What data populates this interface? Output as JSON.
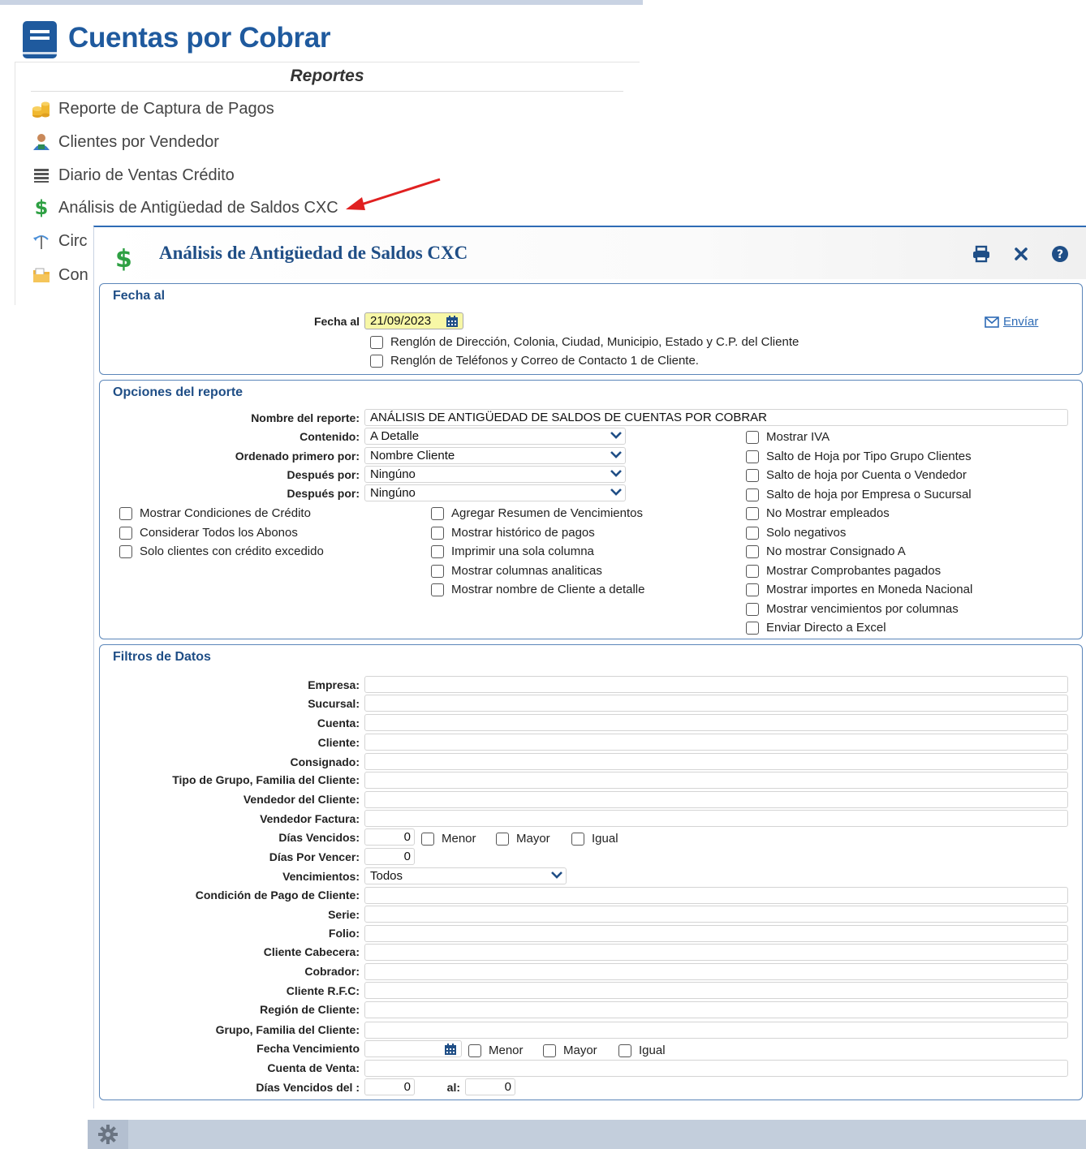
{
  "app": {
    "title": "Cuentas por Cobrar",
    "subtitle": "Reportes"
  },
  "menu_items": [
    {
      "label": "Reporte de Captura de Pagos",
      "icon": "coins-icon"
    },
    {
      "label": "Clientes por Vendedor",
      "icon": "users-icon"
    },
    {
      "label": "Diario de Ventas Crédito",
      "icon": "list-icon"
    },
    {
      "label": "Análisis de Antigüedad de Saldos CXC",
      "icon": "dollar-icon"
    },
    {
      "label": "Circ",
      "icon": "circular-icon"
    },
    {
      "label": "Con",
      "icon": "folder-icon"
    }
  ],
  "dialog": {
    "icon_glyph": "$",
    "title": "Análisis de Antigüedad de Saldos CXC"
  },
  "fecha": {
    "section_title": "Fecha al",
    "label": "Fecha al",
    "value": "21/09/2023",
    "send_link": "Envíar",
    "checks": [
      "Renglón de Dirección, Colonia, Ciudad, Municipio, Estado y C.P. del Cliente",
      "Renglón de Teléfonos y Correo de Contacto 1 de Cliente."
    ]
  },
  "opciones": {
    "section_title": "Opciones del reporte",
    "nombre_label": "Nombre del reporte:",
    "nombre_value": "ANÁLISIS DE ANTIGÜEDAD DE SALDOS DE CUENTAS POR COBRAR",
    "contenido_label": "Contenido:",
    "contenido_value": "A Detalle",
    "ordenado_label": "Ordenado primero por:",
    "ordenado_value": "Nombre Cliente",
    "despues1_label": "Después por:",
    "despues1_value": "Ningúno",
    "despues2_label": "Después por:",
    "despues2_value": "Ningúno",
    "right_checks": [
      "Mostrar IVA",
      "Salto de Hoja por Tipo Grupo Clientes",
      "Salto de hoja por Cuenta o Vendedor",
      "Salto de hoja por Empresa o Sucursal",
      "No Mostrar empleados",
      "Solo negativos",
      "No mostrar Consignado A",
      "Mostrar Comprobantes pagados",
      "Mostrar importes en Moneda Nacional",
      "Mostrar vencimientos por columnas",
      "Enviar Directo a Excel"
    ],
    "left_checks": [
      "Mostrar Condiciones de Crédito",
      "Considerar Todos los Abonos",
      "Solo clientes con crédito excedido"
    ],
    "middle_checks": [
      "Agregar Resumen de Vencimientos",
      "Mostrar histórico de pagos",
      "Imprimir una sola columna",
      "Mostrar columnas analiticas",
      "Mostrar nombre de Cliente a detalle"
    ]
  },
  "filtros": {
    "section_title": "Filtros de Datos",
    "empresa": "Empresa:",
    "sucursal": "Sucursal:",
    "cuenta": "Cuenta:",
    "cliente": "Cliente:",
    "consignado": "Consignado:",
    "tipo_grupo": "Tipo de Grupo, Familia del Cliente:",
    "vendedor_cliente": "Vendedor del Cliente:",
    "vendedor_factura": "Vendedor Factura:",
    "dias_vencidos_label": "Días Vencidos:",
    "dias_vencidos_value": "0",
    "dias_por_vencer_label": "Días Por Vencer:",
    "dias_por_vencer_value": "0",
    "vencimientos_label": "Vencimientos:",
    "vencimientos_value": "Todos",
    "condicion_pago": "Condición de Pago de Cliente:",
    "serie": "Serie:",
    "folio": "Folio:",
    "cliente_cabecera": "Cliente Cabecera:",
    "cobrador": "Cobrador:",
    "cliente_rfc": "Cliente R.F.C:",
    "region_cliente": "Región de Cliente:",
    "grupo_familia": "Grupo, Familia del Cliente:",
    "fecha_vencimiento": "Fecha Vencimiento",
    "cuenta_venta": "Cuenta de Venta:",
    "dias_vencidos_del_label": "Días Vencidos del :",
    "dias_vencidos_del_value": "0",
    "al_label": "al:",
    "al_value": "0",
    "menor": "Menor",
    "mayor": "Mayor",
    "igual": "Igual"
  },
  "colors": {
    "accent": "#1f4e86",
    "border": "#5b86b9",
    "highlight": "#f7f7a6",
    "bottom_bar": "#c3cedc"
  }
}
